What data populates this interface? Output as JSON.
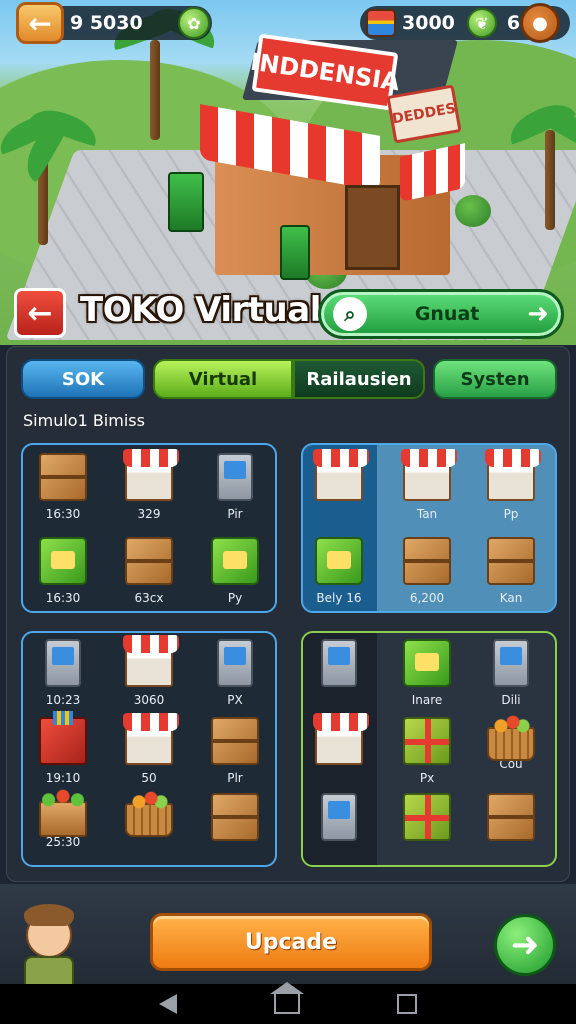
{
  "topbar": {
    "coins": "9 5030",
    "gems": "3000",
    "level": "69"
  },
  "scene": {
    "sign_main": "INDDENSIA",
    "sign_side": "DEDDES"
  },
  "header": {
    "title": "TOKO Virtual",
    "search_label": "Gnuat"
  },
  "tabs": [
    {
      "label": "SOK"
    },
    {
      "label": "Virtual"
    },
    {
      "label": "Railausien"
    },
    {
      "label": "Systen"
    }
  ],
  "section_label": "Simulo1 Bimiss",
  "grid_a": [
    {
      "icon": "crate-stall-icon",
      "label": "16:30"
    },
    {
      "icon": "market-stall-icon",
      "label": "329"
    },
    {
      "icon": "vending-machine-icon",
      "label": "Pir"
    },
    {
      "icon": "green-kiosk-icon",
      "label": "16:30"
    },
    {
      "icon": "crate-icon",
      "label": "63cx"
    },
    {
      "icon": "green-box-icon",
      "label": "Py"
    }
  ],
  "grid_b": [
    {
      "icon": "market-stall-icon",
      "label": ""
    },
    {
      "icon": "market-stall-icon",
      "label": "Tan"
    },
    {
      "icon": "market-stall-icon",
      "label": "Pp"
    },
    {
      "icon": "green-kiosk-icon",
      "label": "Bely 16"
    },
    {
      "icon": "gift-crate-icon",
      "label": "6,200"
    },
    {
      "icon": "crate-icon",
      "label": "Kan"
    }
  ],
  "grid_c": [
    {
      "icon": "vending-machine-icon",
      "label": "10:23"
    },
    {
      "icon": "market-stall-icon",
      "label": "3060"
    },
    {
      "icon": "vending-machine-icon",
      "label": "PX"
    },
    {
      "icon": "red-box-icon",
      "label": "19:10"
    },
    {
      "icon": "market-stall-icon",
      "label": "50"
    },
    {
      "icon": "crate-icon",
      "label": "Plr"
    },
    {
      "icon": "vegetable-crate-icon",
      "label": "25:30"
    },
    {
      "icon": "fruit-basket-icon",
      "label": ""
    },
    {
      "icon": "crate-icon",
      "label": ""
    }
  ],
  "grid_d": [
    {
      "icon": "vending-machine-icon",
      "label": ""
    },
    {
      "icon": "green-crate-icon",
      "label": "Inare"
    },
    {
      "icon": "vending-machine-icon",
      "label": "Dili"
    },
    {
      "icon": "market-stall-icon",
      "label": ""
    },
    {
      "icon": "gift-crate-icon",
      "label": "Px"
    },
    {
      "icon": "fruit-basket-icon",
      "label": "Cou"
    },
    {
      "icon": "vending-machine-icon",
      "label": ""
    },
    {
      "icon": "gift-crate-icon",
      "label": ""
    },
    {
      "icon": "crate-icon",
      "label": ""
    }
  ],
  "footer": {
    "upgrade_label": "Upcade"
  },
  "colors": {
    "accent_green": "#28a046",
    "accent_orange": "#ee7b12",
    "panel_bg": "#252e38",
    "border_blue": "#4da7e8",
    "border_green": "#8bcf4d"
  }
}
